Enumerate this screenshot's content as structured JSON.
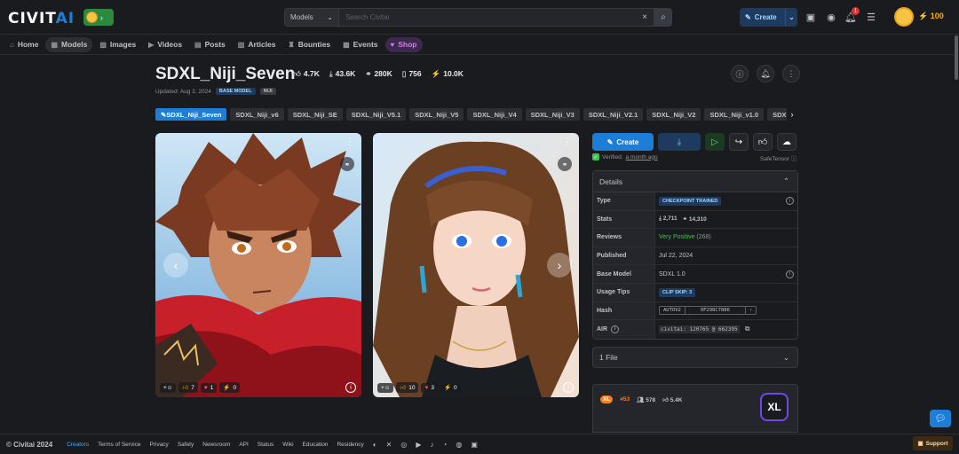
{
  "header": {
    "logo_main": "CIVIT",
    "logo_accent": "AI",
    "search_category": "Models",
    "search_placeholder": "Search Civitai",
    "create_label": "Create",
    "notification_count": "1",
    "buzz_amount": "100"
  },
  "nav": {
    "items": [
      {
        "label": "Home",
        "icon": "home-icon"
      },
      {
        "label": "Models",
        "icon": "models-icon"
      },
      {
        "label": "Images",
        "icon": "images-icon"
      },
      {
        "label": "Videos",
        "icon": "videos-icon"
      },
      {
        "label": "Posts",
        "icon": "posts-icon"
      },
      {
        "label": "Articles",
        "icon": "articles-icon"
      },
      {
        "label": "Bounties",
        "icon": "bounties-icon"
      },
      {
        "label": "Events",
        "icon": "events-icon"
      },
      {
        "label": "Shop",
        "icon": "shop-icon"
      }
    ],
    "active": "Models"
  },
  "model": {
    "title": "SDXL_Niji_Seven",
    "likes": "4.7K",
    "downloads": "43.6K",
    "generations": "280K",
    "collected": "756",
    "buzz": "10.0K",
    "updated": "Updated: Aug 2, 2024",
    "tag_base_model": "BASE MODEL",
    "tag_nijii": "NIJI"
  },
  "versions": [
    "SDXL_Niji_Seven",
    "SDXL_Niji_v6",
    "SDXL_Niji_SE",
    "SDXL_Niji_V5.1",
    "SDXL_Niji_V5",
    "SDXL_Niji_V4",
    "SDXL_Niji_V3",
    "SDXL_Niji_V2.1",
    "SDXL_Niji_V2",
    "SDXL_Niji_v1.0",
    "SDXL_Niji_Beta",
    "SDX"
  ],
  "images": [
    {
      "likes": "7",
      "hearts": "1",
      "buzz": "0"
    },
    {
      "likes": "10",
      "hearts": "3",
      "buzz": "0"
    }
  ],
  "actions": {
    "create": "Create",
    "verified_prefix": "Verified:",
    "verified_time": "a month ago",
    "format": "SafeTensor"
  },
  "details": {
    "heading": "Details",
    "rows": {
      "type_label": "Type",
      "type_value": "CHECKPOINT TRAINED",
      "stats_label": "Stats",
      "stats_downloads": "2,711",
      "stats_generations": "14,310",
      "reviews_label": "Reviews",
      "reviews_value": "Very Positive",
      "reviews_count": "(268)",
      "published_label": "Published",
      "published_value": "Jul 22, 2024",
      "base_label": "Base Model",
      "base_value": "SDXL 1.0",
      "usage_label": "Usage Tips",
      "usage_value": "CLIP SKIP: 3",
      "hash_label": "Hash",
      "hash_type": "AUTOV2",
      "hash_value": "0F298C7886",
      "air_label": "AIR",
      "air_value": "civitai: 120765 @ 662395"
    }
  },
  "files": {
    "label": "1 File"
  },
  "creator": {
    "level_badge": "XL",
    "rank": "#53",
    "followers": "578",
    "likes": "5.4K",
    "emblem": "XL"
  },
  "footer": {
    "copyright": "© Civitai 2024",
    "links": [
      "Creators",
      "Terms of Service",
      "Privacy",
      "Safety",
      "Newsroom",
      "API",
      "Status",
      "Wiki",
      "Education",
      "Residency"
    ],
    "support": "Support"
  }
}
